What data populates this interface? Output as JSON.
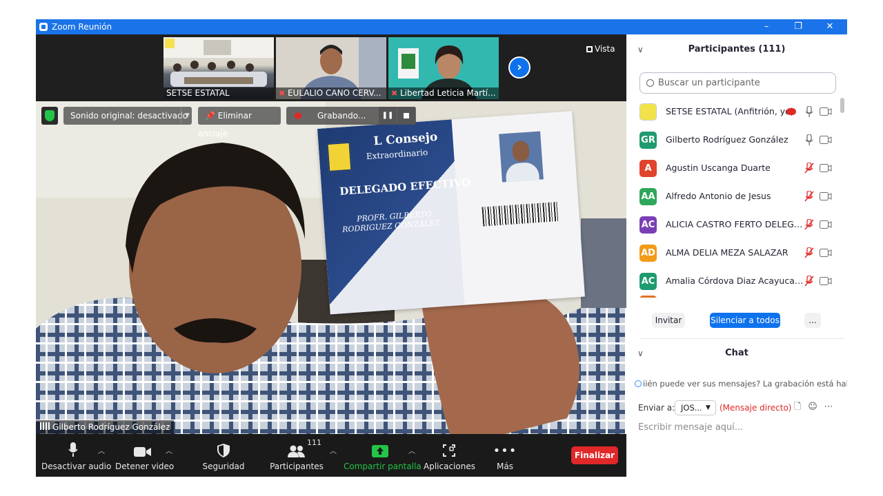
{
  "window": {
    "title": "Zoom Reunión",
    "minimize": "–",
    "restore": "❐",
    "close": "✕"
  },
  "strip": {
    "thumbnails": [
      {
        "name": "SETSE ESTATAL",
        "muted": false
      },
      {
        "name": "EULALIO CANO CERV...",
        "muted": true
      },
      {
        "name": "Libertad Leticia Martí...",
        "muted": true
      }
    ],
    "view_label": "Vista"
  },
  "overlays": {
    "original_sound": "Sonido original: desactivado",
    "unpin": "Eliminar anclaje",
    "recording": "Grabando..."
  },
  "card": {
    "line1": "L Consejo",
    "line2": "Extraordinario",
    "line3": "DELEGADO EFECTIVO",
    "line4": "PROFR. GILBERTO",
    "line5": "RODRIGUEZ GONZALEZ"
  },
  "speaker": {
    "name": "Gilberto Rodríguez González"
  },
  "toolbar": {
    "mute_audio": "Desactivar audio",
    "stop_video": "Detener video",
    "security": "Seguridad",
    "participants": "Participantes",
    "participants_count": "111",
    "share_screen": "Compartir pantalla",
    "apps": "Aplicaciones",
    "more": "Más",
    "end": "Finalizar"
  },
  "participants_panel": {
    "title": "Participantes (111)",
    "search_placeholder": "Buscar un participante",
    "items": [
      {
        "initials": "",
        "name": "SETSE ESTATAL (Anfitrión, yo)",
        "color": "#f2e34b",
        "mic_muted": false
      },
      {
        "initials": "GR",
        "name": "Gilberto Rodríguez González",
        "color": "#1f9b6f",
        "mic_muted": false
      },
      {
        "initials": "A",
        "name": "Agustin Uscanga Duarte",
        "color": "#e0442c",
        "mic_muted": true
      },
      {
        "initials": "AA",
        "name": "Alfredo Antonio de Jesus",
        "color": "#2ea65b",
        "mic_muted": true
      },
      {
        "initials": "AC",
        "name": "ALICIA CASTRO FERTO DELEGAC...",
        "color": "#7b3fb5",
        "mic_muted": true
      },
      {
        "initials": "AD",
        "name": "ALMA DELIA MEZA SALAZAR",
        "color": "#f39b17",
        "mic_muted": true
      },
      {
        "initials": "AC",
        "name": "Amalia Córdova Diaz Acayucan ...",
        "color": "#1f9b6f",
        "mic_muted": true
      }
    ],
    "invite": "Invitar",
    "mute_all": "Silenciar a todos",
    "more": "..."
  },
  "chat": {
    "title": "Chat",
    "notice": "iién puede ver sus mensajes? La grabación está habilit",
    "send_to_label": "Enviar a:",
    "recipient": "JOS...",
    "direct_message": "(Mensaje directo)",
    "input_placeholder": "Escribir mensaje aquí..."
  },
  "colors": {
    "accent": "#0e72ed",
    "end": "#e02828",
    "share": "#23c447"
  }
}
